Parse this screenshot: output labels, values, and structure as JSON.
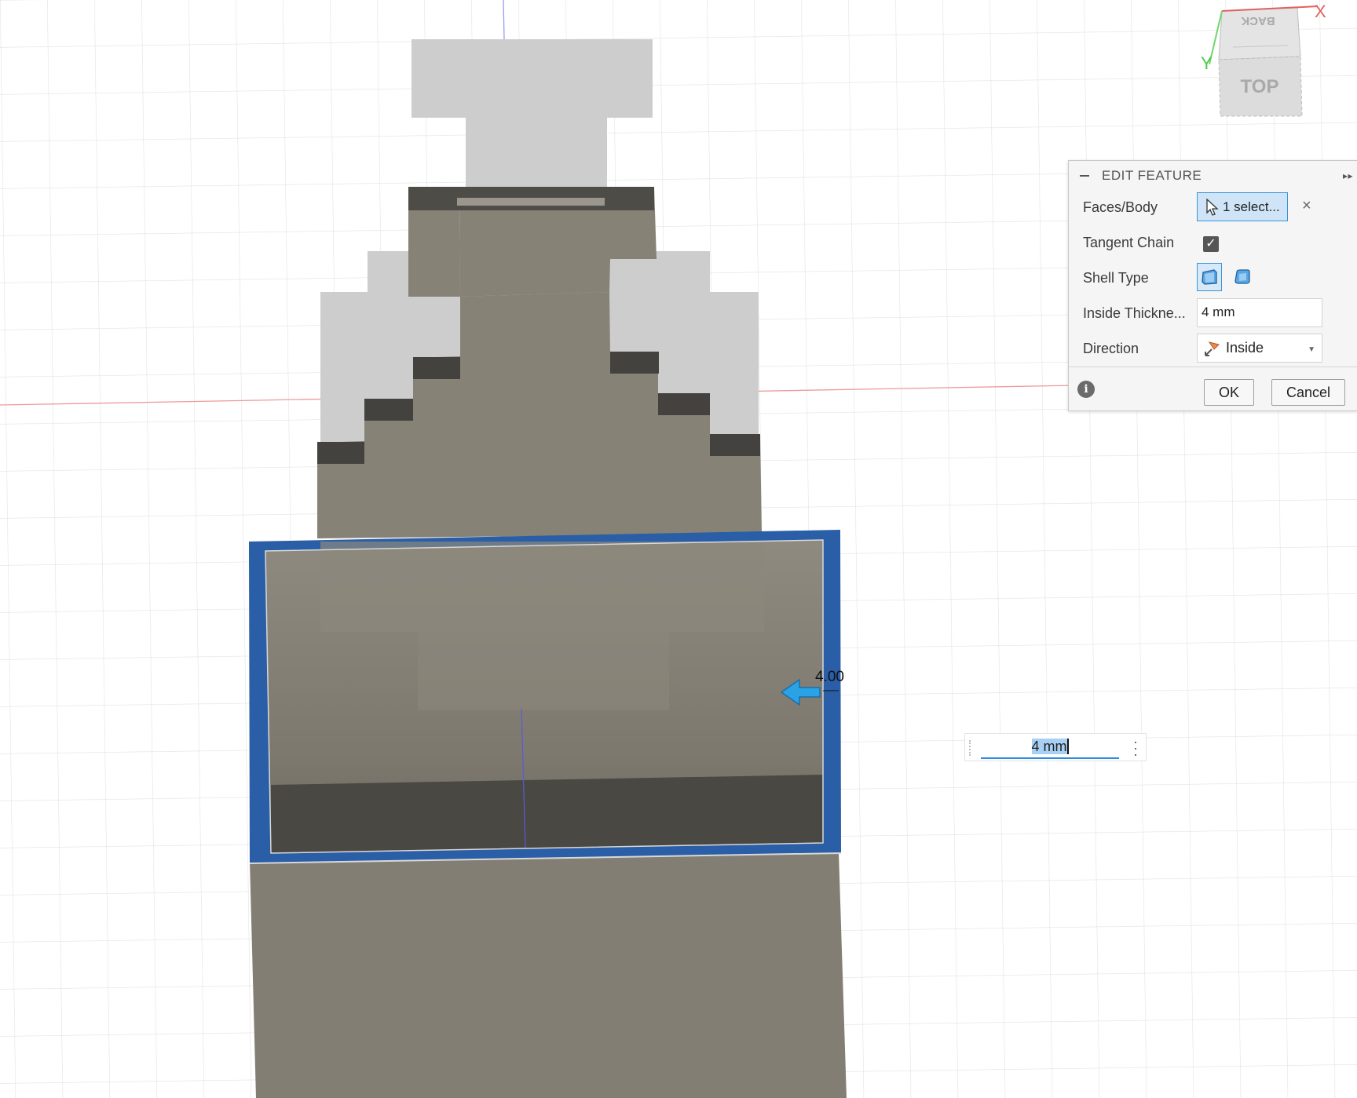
{
  "viewcube": {
    "top_label": "TOP",
    "back_label": "BACK",
    "axis_x": "X",
    "axis_y": "Y"
  },
  "canvas": {
    "dimension_label": "4.00"
  },
  "edit_feature": {
    "title": "EDIT FEATURE",
    "faces_body_label": "Faces/Body",
    "faces_body_value": "1 select...",
    "tangent_chain_label": "Tangent Chain",
    "tangent_chain_checked": true,
    "shell_type_label": "Shell Type",
    "inside_thickness_label": "Inside Thickne...",
    "inside_thickness_value": "4 mm",
    "direction_label": "Direction",
    "direction_value": "Inside",
    "ok_label": "OK",
    "cancel_label": "Cancel"
  },
  "floating_input": {
    "value": "4 mm"
  },
  "colors": {
    "body": "#878276",
    "body_dark": "#4d4b46",
    "ghost": "#cfcfcf",
    "selection": "#2a5ea6",
    "accent": "#3a94d8",
    "grid": "#e2e2e2",
    "axis_red": "#e88c8c",
    "axis_blue": "#8a8af0"
  }
}
